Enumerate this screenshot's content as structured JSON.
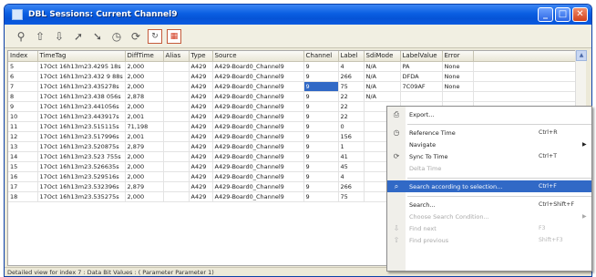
{
  "window": {
    "title": "DBL Sessions: Current Channel9",
    "minimize": "_",
    "maximize": "□",
    "close": "✕"
  },
  "toolbar": {
    "icons": [
      "zoom-icon",
      "up-arrow-icon",
      "down-arrow-icon",
      "search-up-icon",
      "search-down-icon",
      "clock-icon",
      "sync-icon",
      "refresh-icon",
      "grid-icon"
    ]
  },
  "grid": {
    "columns": [
      "Index",
      "TimeTag",
      "DiffTime",
      "Alias",
      "Type",
      "Source",
      "Channel",
      "Label",
      "SdiMode",
      "LabelValue",
      "Error"
    ],
    "rows": [
      [
        "5",
        "17Oct 16h13m23.4295 18s",
        "2,000",
        "",
        "A429",
        "A429-Board0_Channel9",
        "9",
        "4",
        "N/A",
        "PA",
        "None"
      ],
      [
        "6",
        "17Oct 16h13m23.432 9 88s",
        "2,000",
        "",
        "A429",
        "A429-Board0_Channel9",
        "9",
        "266",
        "N/A",
        "DFDA",
        "None"
      ],
      [
        "7",
        "17Oct 16h13m23.435278s",
        "2,000",
        "",
        "A429",
        "A429-Board0_Channel9",
        "9",
        "75",
        "N/A",
        "7C09AF",
        "None"
      ],
      [
        "8",
        "17Oct 16h13m23.438 056s",
        "2,878",
        "",
        "A429",
        "A429-Board0_Channel9",
        "9",
        "22",
        "N/A",
        "",
        ""
      ],
      [
        "9",
        "17Oct 16h13m23.441056s",
        "2,000",
        "",
        "A429",
        "A429-Board0_Channel9",
        "9",
        "22",
        "",
        "",
        ""
      ],
      [
        "10",
        "17Oct 16h13m23.443917s",
        "2,001",
        "",
        "A429",
        "A429-Board0_Channel9",
        "9",
        "22",
        "",
        "",
        ""
      ],
      [
        "11",
        "17Oct 16h13m23.515115s",
        "71,198",
        "",
        "A429",
        "A429-Board0_Channel9",
        "9",
        "0",
        "",
        "",
        ""
      ],
      [
        "12",
        "17Oct 16h13m23.517996s",
        "2,001",
        "",
        "A429",
        "A429-Board0_Channel9",
        "9",
        "156",
        "",
        "",
        ""
      ],
      [
        "13",
        "17Oct 16h13m23.520875s",
        "2,879",
        "",
        "A429",
        "A429-Board0_Channel9",
        "9",
        "1",
        "",
        "",
        ""
      ],
      [
        "14",
        "17Oct 16h13m23.523 755s",
        "2,000",
        "",
        "A429",
        "A429-Board0_Channel9",
        "9",
        "41",
        "",
        "",
        ""
      ],
      [
        "15",
        "17Oct 16h13m23.526635s",
        "2,000",
        "",
        "A429",
        "A429-Board0_Channel9",
        "9",
        "45",
        "",
        "",
        ""
      ],
      [
        "16",
        "17Oct 16h13m23.529516s",
        "2,000",
        "",
        "A429",
        "A429-Board0_Channel9",
        "9",
        "4",
        "",
        "",
        ""
      ],
      [
        "17",
        "17Oct 16h13m23.532396s",
        "2,879",
        "",
        "A429",
        "A429-Board0_Channel9",
        "9",
        "266",
        "",
        "",
        ""
      ],
      [
        "18",
        "17Oct 16h13m23.535275s",
        "2,000",
        "",
        "A429",
        "A429-Board0_Channel9",
        "9",
        "75",
        "",
        "",
        ""
      ]
    ],
    "selected_row": 2,
    "selected_col": 6
  },
  "status": {
    "text": "Detailed view for index 7 : Data Bit Values : ( Parameter Parameter 1)"
  },
  "context_menu": {
    "items": [
      {
        "label": "Export...",
        "shortcut": "",
        "icon": "export-icon",
        "glyph": "⎙",
        "disabled": false,
        "highlight": false,
        "sub": ""
      },
      {
        "sep": true
      },
      {
        "label": "Reference Time",
        "shortcut": "Ctrl+R",
        "icon": "clock-icon",
        "glyph": "◷",
        "disabled": false,
        "highlight": false,
        "sub": ""
      },
      {
        "label": "Navigate",
        "shortcut": "",
        "icon": "",
        "glyph": "",
        "disabled": false,
        "highlight": false,
        "sub": "▶"
      },
      {
        "label": "Sync To Time",
        "shortcut": "Ctrl+T",
        "icon": "sync-icon",
        "glyph": "⟳",
        "disabled": false,
        "highlight": false,
        "sub": ""
      },
      {
        "label": "Delta Time",
        "shortcut": "",
        "icon": "",
        "glyph": "",
        "disabled": true,
        "highlight": false,
        "sub": ""
      },
      {
        "sep": true
      },
      {
        "label": "Search according to selection...",
        "shortcut": "Ctrl+F",
        "icon": "search-icon",
        "glyph": "⌕",
        "disabled": false,
        "highlight": true,
        "sub": ""
      },
      {
        "sep": true
      },
      {
        "label": "Search...",
        "shortcut": "Ctrl+Shift+F",
        "icon": "",
        "glyph": "",
        "disabled": false,
        "highlight": false,
        "sub": ""
      },
      {
        "label": "Choose Search Condition...",
        "shortcut": "",
        "icon": "",
        "glyph": "",
        "disabled": true,
        "highlight": false,
        "sub": "▶"
      },
      {
        "label": "Find next",
        "shortcut": "F3",
        "icon": "down-arrow-icon",
        "glyph": "⇩",
        "disabled": true,
        "highlight": false,
        "sub": ""
      },
      {
        "label": "Find previous",
        "shortcut": "Shift+F3",
        "icon": "up-arrow-icon",
        "glyph": "⇧",
        "disabled": true,
        "highlight": false,
        "sub": ""
      }
    ]
  }
}
